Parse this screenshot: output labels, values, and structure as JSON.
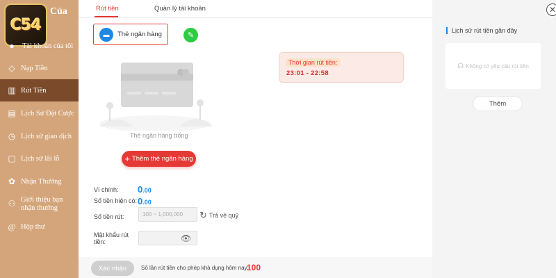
{
  "sidebar": {
    "logo_text": "C54",
    "title_suffix": "Của",
    "items": [
      {
        "label": "Tài khoản của tôi",
        "icon": "user-icon"
      },
      {
        "label": "Nạp Tiền",
        "icon": "tag-icon"
      },
      {
        "label": "Rút Tiền",
        "icon": "chart-icon"
      },
      {
        "label": "Lịch Sử Đặt Cược",
        "icon": "clipboard-icon"
      },
      {
        "label": "Lịch sử giao dịch",
        "icon": "clock-icon"
      },
      {
        "label": "Lịch sử lãi lỗ",
        "icon": "document-icon"
      },
      {
        "label": "Nhận Thưởng",
        "icon": "gift-icon"
      },
      {
        "label": "Giới thiệu bạn nhận thưởng",
        "icon": "users-icon"
      },
      {
        "label": "Hộp thư",
        "icon": "mail-icon"
      }
    ],
    "active_index": 2
  },
  "tabs": [
    {
      "label": "Rút tiền",
      "active": true
    },
    {
      "label": "Quản lý tài khoản",
      "active": false
    }
  ],
  "card_tab": {
    "label": "Thẻ ngân hàng",
    "icon": "bank-card-icon"
  },
  "empty_state": {
    "text": "Thẻ ngân hàng trống"
  },
  "add_card_button": "Thêm thẻ ngân hàng",
  "withdraw_time": {
    "label": "Thời gian rút tiền:",
    "value": "23:01  - 22:58"
  },
  "form": {
    "main_wallet_label": "Ví chính:",
    "main_wallet_value": "0",
    "main_wallet_decimal": ".00",
    "balance_label": "Số tiền hiện có:",
    "balance_value": "0",
    "balance_decimal": ".00",
    "amount_label": "Số tiền rút:",
    "amount_placeholder": "100 ~ 1,000,000",
    "return_label": "Trả về quỹ",
    "password_label": "Mật khẩu rút tiền:",
    "password_value": ""
  },
  "footer": {
    "confirm_label": "Xác nhận",
    "limit_text": "Số lần rút tiền cho phép khả dụng hôm nay:",
    "limit_value": "100"
  },
  "right_panel": {
    "title": "Lịch sử rút tiền gần đây",
    "empty_text": "Không có yêu cầu rút tiền",
    "more_label": "Thêm"
  },
  "colors": {
    "sidebar": "#d4a57a",
    "active": "#7a4a2a",
    "accent": "#e53935",
    "blue": "#1e88e5"
  }
}
